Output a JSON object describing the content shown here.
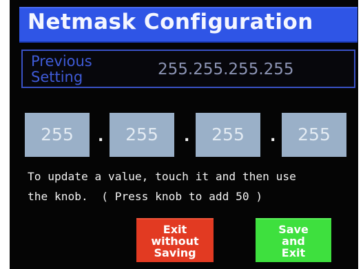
{
  "header": {
    "title": "Netmask Configuration"
  },
  "previous": {
    "label": "Previous\nSetting",
    "value": "255.255.255.255"
  },
  "octets": [
    "255",
    "255",
    "255",
    "255"
  ],
  "separator": ".",
  "instructions": "To update a value, touch it and then use\nthe knob.  ( Press knob to add 50 )",
  "buttons": {
    "exit_without_saving": "Exit\nwithout\nSaving",
    "save_and_exit": "Save\nand\nExit"
  },
  "colors": {
    "title_bar": "#2f55e6",
    "octet_field": "#9ab0c8",
    "exit_button": "#e23a22",
    "save_button": "#3ee03e",
    "previous_label": "#3f5bd8"
  }
}
